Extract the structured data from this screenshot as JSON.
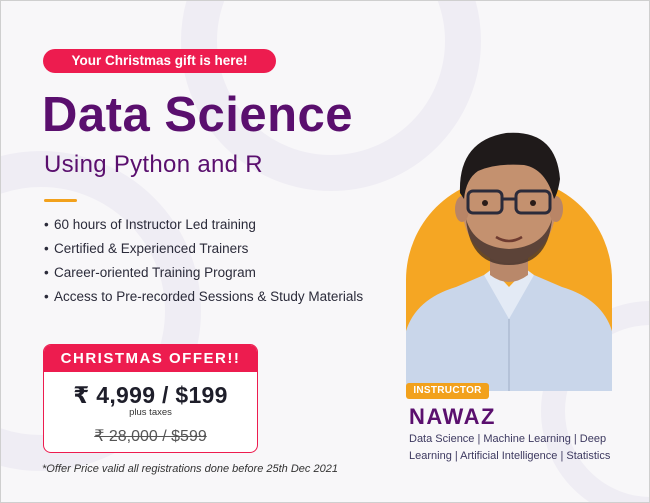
{
  "banner": {
    "gift_badge": "Your Christmas gift is here!",
    "title": "Data Science",
    "subtitle": "Using Python and R",
    "features": [
      "60 hours of Instructor Led training",
      "Certified & Experienced Trainers",
      "Career-oriented Training Program",
      "Access to Pre-recorded Sessions & Study Materials"
    ],
    "bullet": "•",
    "offer": {
      "heading": "CHRISTMAS OFFER!!",
      "price": "₹ 4,999 / $199",
      "taxes": "plus taxes",
      "old_price": "₹ 28,000 / $599"
    },
    "footnote": "*Offer Price valid all registrations done before 25th Dec 2021",
    "instructor": {
      "tag": "INSTRUCTOR",
      "name": "NAWAZ",
      "skills": "Data Science | Machine Learning | Deep Learning | Artificial Intelligence | Statistics"
    }
  },
  "colors": {
    "accent_red": "#ed1c4f",
    "brand_purple": "#5a0f6e",
    "accent_orange": "#f5a623",
    "background": "#f8f7f9"
  }
}
